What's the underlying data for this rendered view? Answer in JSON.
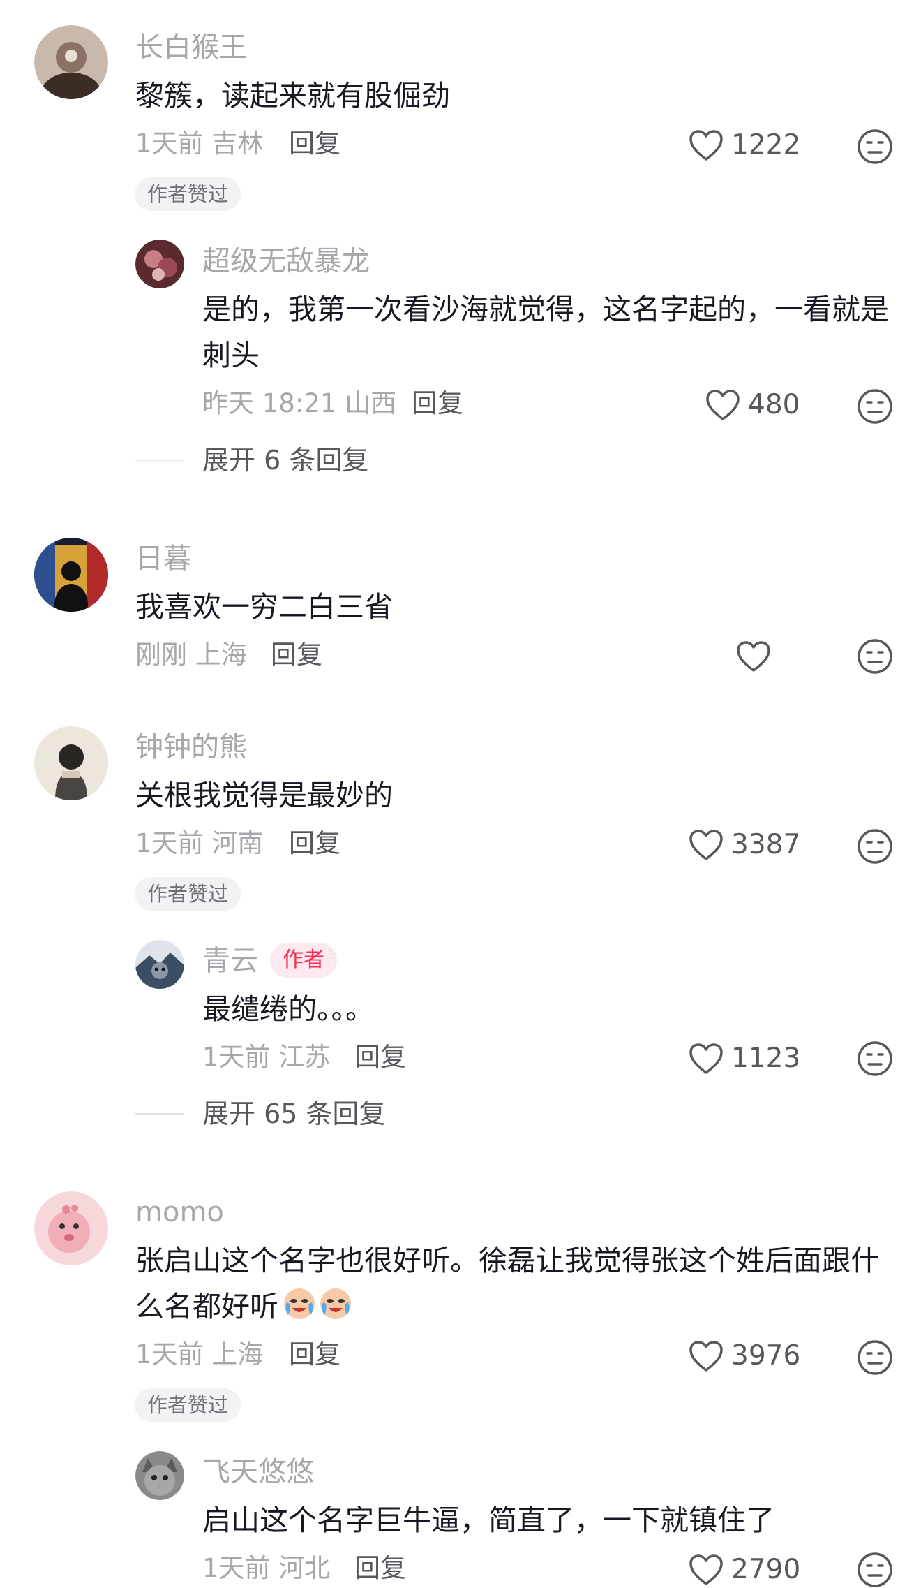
{
  "colors": {
    "accent": "#fe2c55",
    "muted_text": "#a6a7ab",
    "body_text": "#161823",
    "secondary_text": "#57585e"
  },
  "comments": [
    {
      "username": "长白猴王",
      "text": "黎簇，读起来就有股倔劲",
      "time_loc": "1天前 吉林",
      "reply_label": "回复",
      "likes": "1222",
      "author_liked_badge": "作者赞过",
      "replies": [
        {
          "username": "超级无敌暴龙",
          "text": "是的，我第一次看沙海就觉得，这名字起的，一看就是刺头",
          "time_loc": "昨天 18:21 山西",
          "reply_label": "回复",
          "likes": "480"
        }
      ],
      "expand_label": "展开 6 条回复"
    },
    {
      "username": "日暮",
      "text": "我喜欢一穷二白三省",
      "time_loc": "刚刚 上海",
      "reply_label": "回复",
      "likes": ""
    },
    {
      "username": "钟钟的熊",
      "text": "关根我觉得是最妙的",
      "time_loc": "1天前 河南",
      "reply_label": "回复",
      "likes": "3387",
      "author_liked_badge": "作者赞过",
      "replies": [
        {
          "username": "青云",
          "author_tag": "作者",
          "text": "最缱绻的。。。",
          "time_loc": "1天前 江苏",
          "reply_label": "回复",
          "likes": "1123"
        }
      ],
      "expand_label": "展开 65 条回复"
    },
    {
      "username": "momo",
      "text": "张启山这个名字也很好听。徐磊让我觉得张这个姓后面跟什么名都好听",
      "time_loc": "1天前 上海",
      "reply_label": "回复",
      "likes": "3976",
      "author_liked_badge": "作者赞过",
      "replies": [
        {
          "username": "飞天悠悠",
          "text": "启山这个名字巨牛逼，简直了，一下就镇住了",
          "time_loc": "1天前 河北",
          "reply_label": "回复",
          "likes": "2790"
        }
      ]
    }
  ],
  "icons": {
    "like": "heart-outline-icon",
    "dislike": "neutral-face-icon",
    "emoji": "crying-laughing-face-emoji"
  }
}
